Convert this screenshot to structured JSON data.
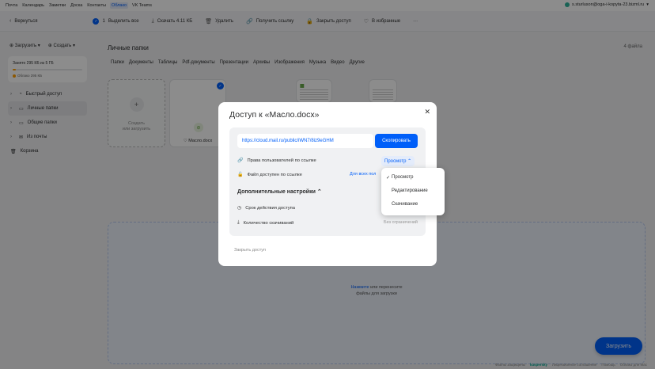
{
  "portal": {
    "links": [
      "Почта",
      "Календарь",
      "Заметки",
      "Доска",
      "Контакты",
      "Облако",
      "VK Teams"
    ],
    "active_index": 5,
    "user_email": "s.sturluson@oga-i-kopyta-23.bizml.ru"
  },
  "toolbar": {
    "back": "Вернуться",
    "selected_count": "1",
    "select_all": "Выделить все",
    "download": "Скачать 4.11 КБ",
    "delete": "Удалить",
    "get_link": "Получить ссылку",
    "close_access": "Закрыть доступ",
    "favorites": "В избранные",
    "more": "···"
  },
  "sidebar": {
    "upload": "Загрузить",
    "create": "Создать",
    "quota_text": "Занято 295 КБ из 5 ГБ",
    "quota_legend": "Облако 295 КБ",
    "quota_fill": 0.04,
    "items": [
      {
        "label": "Быстрый доступ",
        "icon": "clock-icon"
      },
      {
        "label": "Личные папки",
        "icon": "folder-icon"
      },
      {
        "label": "Общие папки",
        "icon": "shared-folder-icon"
      },
      {
        "label": "Из почты",
        "icon": "mail-icon"
      },
      {
        "label": "Корзина",
        "icon": "trash-icon"
      }
    ]
  },
  "main": {
    "title": "Личные папки",
    "file_count": "4 файла",
    "filters": [
      "Папки",
      "Документы",
      "Таблицы",
      "Pdf-документы",
      "Презентации",
      "Архивы",
      "Изображения",
      "Музыка",
      "Видео",
      "Другие"
    ],
    "create_label_1": "Создать",
    "create_label_2": "или загрузить",
    "file_name": "Масло.docx",
    "drop_link": "Нажмите",
    "drop_text_1": "или перенесите",
    "drop_text_2": "файлы для загрузки",
    "upload_button": "Загрузить",
    "footer": [
      "Файлы защищены",
      "kaspersky",
      "Лицензионное соглашение",
      "Помощь",
      "Облако для Mac"
    ]
  },
  "modal": {
    "title": "Доступ к «Масло.docx»",
    "url": "https://cloud.mail.ru/public/iWN7/8iz9eGHM",
    "copy_button": "Скопировать",
    "perm_label": "Права пользователей по ссылке",
    "perm_value": "Просмотр",
    "available_label": "Файл доступен по ссылке",
    "available_value": "Для всех пол",
    "extra_settings": "Дополнительные настройки",
    "expiry_label": "Срок действия доступа",
    "downloads_label": "Количество скачиваний",
    "downloads_value": "Без ограничений",
    "close_access": "Закрыть доступ"
  },
  "dropdown": {
    "options": [
      "Просмотр",
      "Редактирование",
      "Скачивание"
    ],
    "selected_index": 0
  },
  "colors": {
    "accent": "#005ff9",
    "quota": "#ff9e00"
  }
}
